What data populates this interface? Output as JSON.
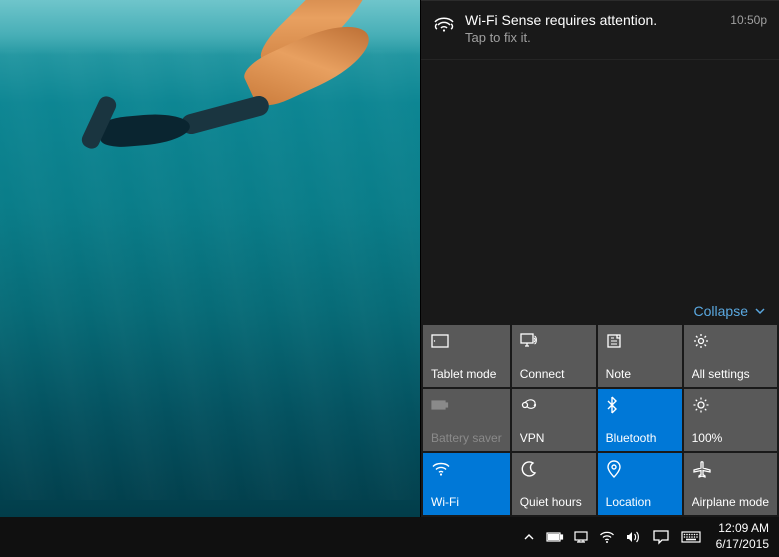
{
  "notification": {
    "title": "Wi-Fi Sense requires attention.",
    "subtitle": "Tap to fix it.",
    "time": "10:50p"
  },
  "collapse_label": "Collapse",
  "quick_actions": [
    {
      "label": "Tablet mode",
      "icon": "tablet",
      "active": false,
      "disabled": false
    },
    {
      "label": "Connect",
      "icon": "connect",
      "active": false,
      "disabled": false
    },
    {
      "label": "Note",
      "icon": "note",
      "active": false,
      "disabled": false
    },
    {
      "label": "All settings",
      "icon": "settings",
      "active": false,
      "disabled": false
    },
    {
      "label": "Battery saver",
      "icon": "battery",
      "active": false,
      "disabled": true
    },
    {
      "label": "VPN",
      "icon": "vpn",
      "active": false,
      "disabled": false
    },
    {
      "label": "Bluetooth",
      "icon": "bluetooth",
      "active": true,
      "disabled": false
    },
    {
      "label": "100%",
      "icon": "brightness",
      "active": false,
      "disabled": false
    },
    {
      "label": "Wi-Fi",
      "icon": "wifi",
      "active": true,
      "disabled": false
    },
    {
      "label": "Quiet hours",
      "icon": "quiet",
      "active": false,
      "disabled": false
    },
    {
      "label": "Location",
      "icon": "location",
      "active": true,
      "disabled": false
    },
    {
      "label": "Airplane mode",
      "icon": "airplane",
      "active": false,
      "disabled": false
    }
  ],
  "taskbar": {
    "time": "12:09 AM",
    "date": "6/17/2015"
  }
}
